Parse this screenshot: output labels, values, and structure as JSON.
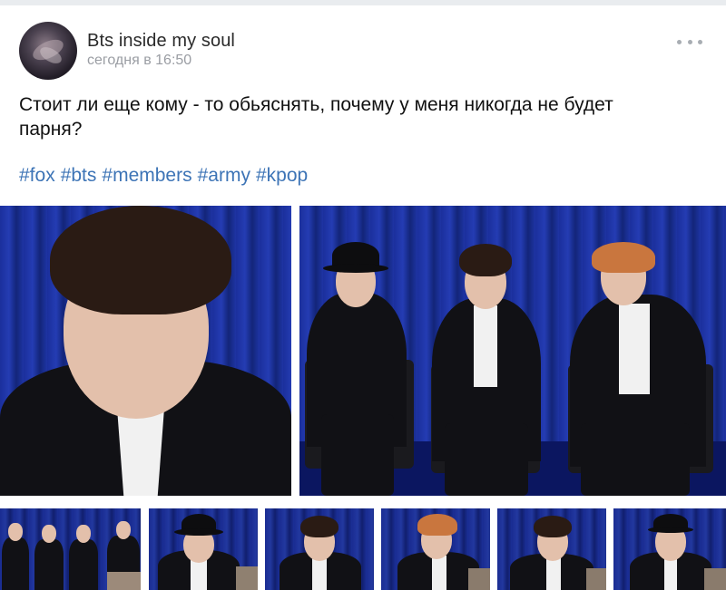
{
  "post": {
    "author": "Bts inside my soul",
    "time": "сегодня в 16:50",
    "text_line1": "Стоит ли еще кому - то обьяснять, почему у меня никогда не будет",
    "text_line2": "парня?",
    "hashtags": [
      "#fox",
      "#bts",
      "#members",
      "#army",
      "#kpop"
    ],
    "more_icon": "more-horizontal-icon"
  },
  "colors": {
    "hashtag": "#3d74b6",
    "meta": "#9a9da3",
    "curtain": "#1e34a4"
  },
  "photos": {
    "count_large": 2,
    "count_thumbs": 6
  }
}
